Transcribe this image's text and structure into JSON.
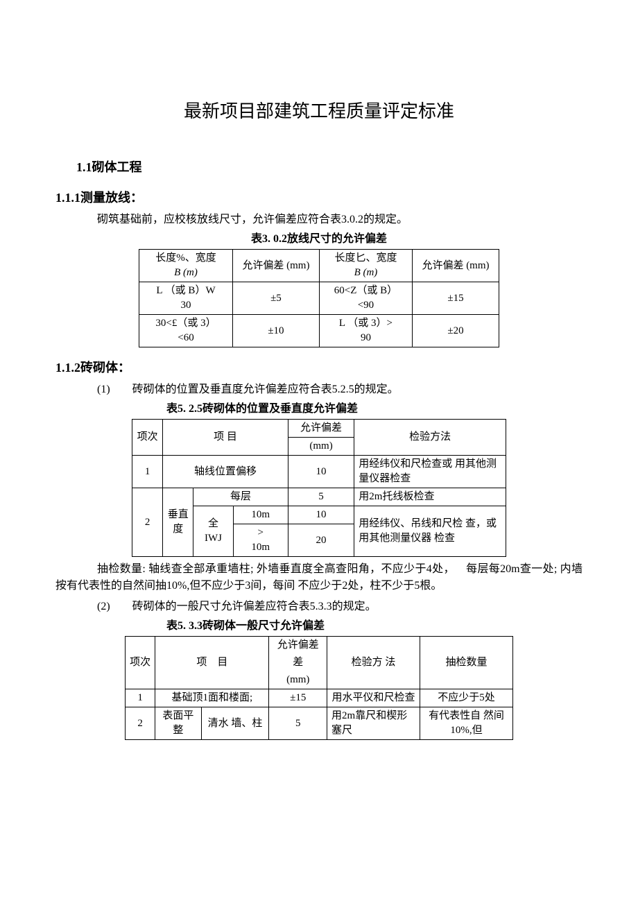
{
  "title": "最新项目部建筑工程质量评定标准",
  "section1": "1.1砌体工程",
  "section1_1": "1.1.1测量放线：",
  "section1_1_text": "砌筑基础前，应校核放线尺寸，允许偏差应符合表3.0.2的规定。",
  "table1_caption": "表3. 0.2放线尺寸的允许偏差",
  "table1": {
    "h1": "长度%、宽度",
    "h1b": "B (m)",
    "h2": "允许偏差 (mm)",
    "h3": "长度匕、宽度",
    "h3b": "B (m)",
    "h4": "允许偏差 (mm)",
    "r1c1": "L （或 B）W",
    "r1c1b": "30",
    "r1c2": "±5",
    "r1c3": "60<Z（或 B）",
    "r1c3b": "<90",
    "r1c4": "±15",
    "r2c1": "30<£（或 3）",
    "r2c1b": "<60",
    "r2c2": "±10",
    "r2c3": "L （或 3）>",
    "r2c3b": "90",
    "r2c4": "±20"
  },
  "section1_2": "1.1.2砖砌体：",
  "section1_2_item1": "(1)  砖砌体的位置及垂直度允许偏差应符合表5.2.5的规定。",
  "table2_caption": "表5. 2.5砖砌体的位置及垂直度允许偏差",
  "table2": {
    "h1": "项次",
    "h2": "项 目",
    "h3": "允许偏差",
    "h3b": "(mm)",
    "h4": "检验方法",
    "r1c1": "1",
    "r1c2": "轴线位置偏移",
    "r1c3": "10",
    "r1c4": "用经纬仪和尺检查或 用其他测量仪器检查",
    "r2c1": "2",
    "r2c2": "垂直度",
    "r2c3a": "每层",
    "r2c3b": "全\nIWJ",
    "r2c3c": "10m",
    "r2c3d": ">\n10m",
    "r2c4a": "5",
    "r2c4b": "10",
    "r2c4c": "20",
    "r2c5a": "用2m托线板检查",
    "r2c5b": "用经纬仪、吊线和尺检 查，或用其他测量仪器 检查"
  },
  "table2_note": "抽检数量: 轴线查全部承重墙柱; 外墙垂直度全高查阳角，不应少于4处， 每层每20m查一处; 内墙按有代表性的自然间抽10%,但不应少于3间，每间 不应少于2处，柱不少于5根。",
  "section1_2_item2": "(2)  砖砌体的一般尺寸允许偏差应符合表5.3.3的规定。",
  "table3_caption": "表5. 3.3砖砌体一般尺寸允许偏差",
  "table3": {
    "h1": "项次",
    "h2": "项 目",
    "h3": "允许偏差",
    "h3b": "(mm)",
    "h4": "检验方 法",
    "h5": "抽检数量",
    "r1c1": "1",
    "r1c2": "基础顶1面和楼面;",
    "r1c3": "±15",
    "r1c4": "用水平仪和尺检查",
    "r1c5": "不应少于5处",
    "r2c1": "2",
    "r2c2a": "表面平整",
    "r2c2b": "清水 墙、柱",
    "r2c3": "5",
    "r2c4": "用2m靠尺和楔形塞尺",
    "r2c5": "有代表性自 然间10%,但"
  }
}
